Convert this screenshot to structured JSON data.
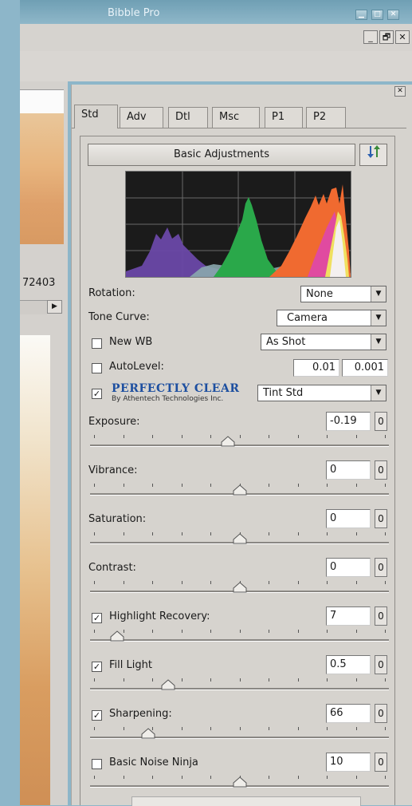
{
  "window": {
    "title": "Bibble Pro"
  },
  "left": {
    "number": "72403"
  },
  "tabs": [
    "Std",
    "Adv",
    "Dtl",
    "Msc",
    "P1",
    "P2"
  ],
  "section": {
    "title": "Basic Adjustments"
  },
  "rotation": {
    "label": "Rotation:",
    "value": "None"
  },
  "tone_curve": {
    "label": "Tone Curve:",
    "value": "Camera"
  },
  "new_wb": {
    "label": "New WB",
    "checked": false,
    "value": "As Shot"
  },
  "autolevel": {
    "label": "AutoLevel:",
    "checked": false,
    "value1": "0.01",
    "value2": "0.001"
  },
  "perfectly_clear": {
    "brand": "PERFECTLY CLEAR",
    "byline": "By Athentech Technologies Inc.",
    "checked": true,
    "value": "Tint Std"
  },
  "sliders": [
    {
      "label": "Exposure:",
      "value": "-0.19",
      "reset": "0",
      "checkbox": false,
      "checked": false,
      "level": 0.46
    },
    {
      "label": "Vibrance:",
      "value": "0",
      "reset": "0",
      "checkbox": false,
      "checked": false,
      "level": 0.5
    },
    {
      "label": "Saturation:",
      "value": "0",
      "reset": "0",
      "checkbox": false,
      "checked": false,
      "level": 0.5
    },
    {
      "label": "Contrast:",
      "value": "0",
      "reset": "0",
      "checkbox": false,
      "checked": false,
      "level": 0.5
    },
    {
      "label": "Highlight Recovery:",
      "value": "7",
      "reset": "0",
      "checkbox": true,
      "checked": true,
      "level": 0.07
    },
    {
      "label": "Fill Light",
      "value": "0.5",
      "reset": "0",
      "checkbox": true,
      "checked": true,
      "level": 0.25
    },
    {
      "label": "Sharpening:",
      "value": "66",
      "reset": "0",
      "checkbox": true,
      "checked": true,
      "level": 0.18
    },
    {
      "label": "Basic Noise Ninja",
      "value": "10",
      "reset": "0",
      "checkbox": true,
      "checked": false,
      "level": 0.5
    }
  ]
}
